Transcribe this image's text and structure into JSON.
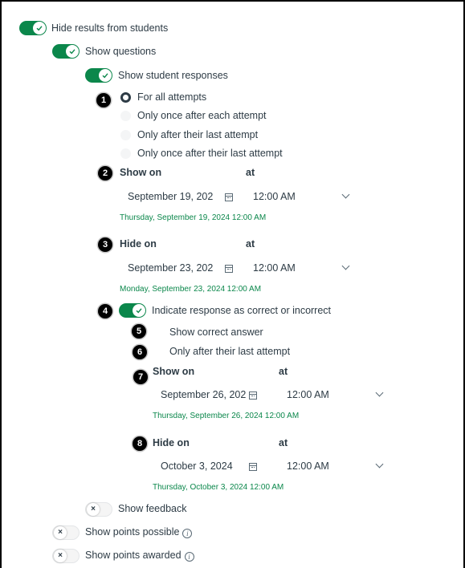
{
  "hide_results": {
    "label": "Hide results from students",
    "on": true
  },
  "show_questions": {
    "label": "Show questions",
    "on": true
  },
  "show_student_responses": {
    "label": "Show student responses",
    "on": true
  },
  "attempts": {
    "options": [
      "For all attempts",
      "Only once after each attempt",
      "Only after their last attempt",
      "Only once after their last attempt"
    ],
    "selected_index": 0
  },
  "show_on": {
    "label": "Show on",
    "at_label": "at",
    "date": "September 19, 202",
    "time": "12:00 AM",
    "summary": "Thursday, September 19, 2024 12:00 AM"
  },
  "hide_on": {
    "label": "Hide on",
    "at_label": "at",
    "date": "September 23, 202",
    "time": "12:00 AM",
    "summary": "Monday, September 23, 2024 12:00 AM"
  },
  "indicate_response": {
    "label": "Indicate response as correct or incorrect",
    "on": true
  },
  "show_correct_answer": {
    "label": "Show correct answer"
  },
  "only_after_last": {
    "label": "Only after their last attempt"
  },
  "correct_show_on": {
    "label": "Show on",
    "at_label": "at",
    "date": "September 26, 202",
    "time": "12:00 AM",
    "summary": "Thursday, September 26, 2024 12:00 AM"
  },
  "correct_hide_on": {
    "label": "Hide on",
    "at_label": "at",
    "date": "October 3, 2024",
    "time": "12:00 AM",
    "summary": "Thursday, October 3, 2024 12:00 AM"
  },
  "show_feedback": {
    "label": "Show feedback",
    "on": false
  },
  "show_points_possible": {
    "label": "Show points possible",
    "on": false
  },
  "show_points_awarded": {
    "label": "Show points awarded",
    "on": false
  },
  "badges": [
    "1",
    "2",
    "3",
    "4",
    "5",
    "6",
    "7",
    "8"
  ],
  "colors": {
    "toggle_on": "#0b874b",
    "summary_text": "#0b874b",
    "text": "#2d3b45",
    "badge": "#000000"
  },
  "icons": {
    "on_knob": "check-icon",
    "off_knob": "x-icon",
    "date": "calendar-icon",
    "time": "chevron-down-icon",
    "info": "info-icon"
  },
  "off_glyph": "×",
  "info_glyph": "i"
}
